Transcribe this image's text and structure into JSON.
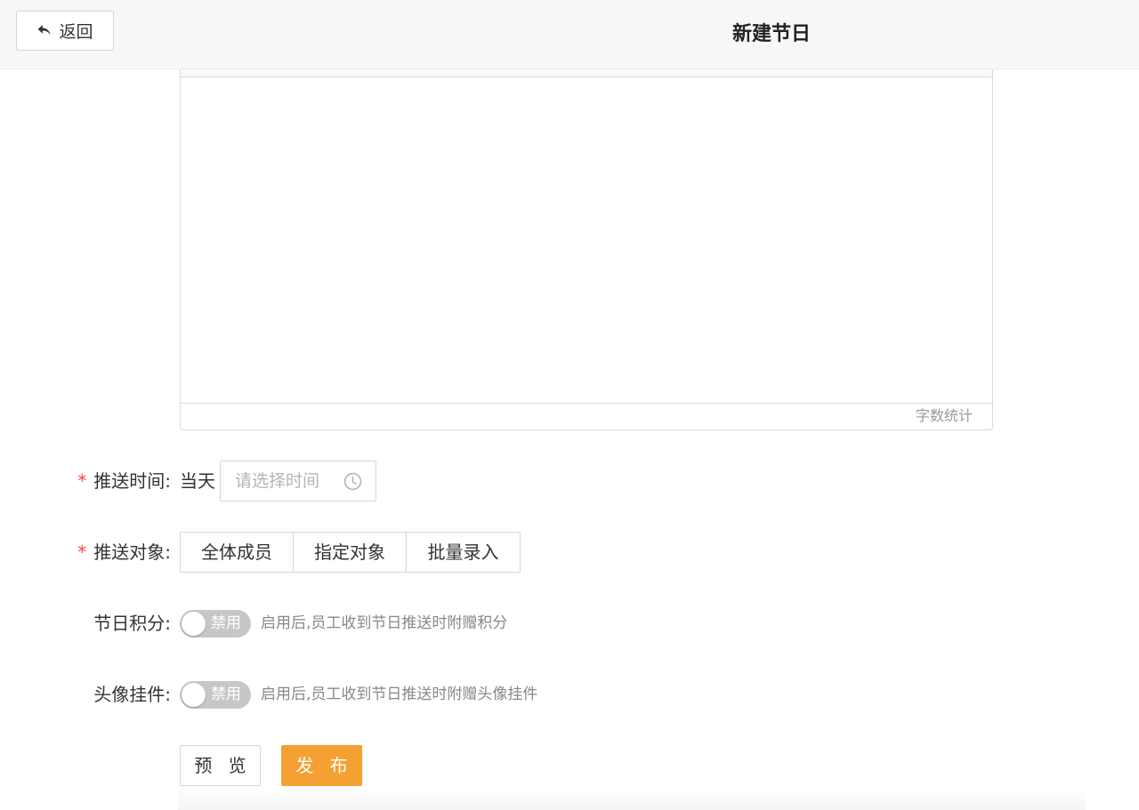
{
  "header": {
    "back_label": "返回",
    "title": "新建节日"
  },
  "editor": {
    "word_count_label": "字数统计"
  },
  "push_time": {
    "required_mark": "*",
    "label": "推送时间:",
    "day_text": "当天",
    "time_placeholder": "请选择时间"
  },
  "push_target": {
    "required_mark": "*",
    "label": "推送对象:",
    "options": [
      "全体成员",
      "指定对象",
      "批量录入"
    ]
  },
  "holiday_points": {
    "label": "节日积分:",
    "toggle_text": "禁用",
    "enabled": false,
    "hint": "启用后,员工收到节日推送时附赠积分"
  },
  "avatar_pendant": {
    "label": "头像挂件:",
    "toggle_text": "禁用",
    "enabled": false,
    "hint": "启用后,员工收到节日推送时附赠头像挂件"
  },
  "actions": {
    "preview_label": "预 览",
    "publish_label": "发 布"
  },
  "colors": {
    "primary": "#f5a032",
    "required": "#f04b3d",
    "toggle_off": "#c7c7c7"
  }
}
